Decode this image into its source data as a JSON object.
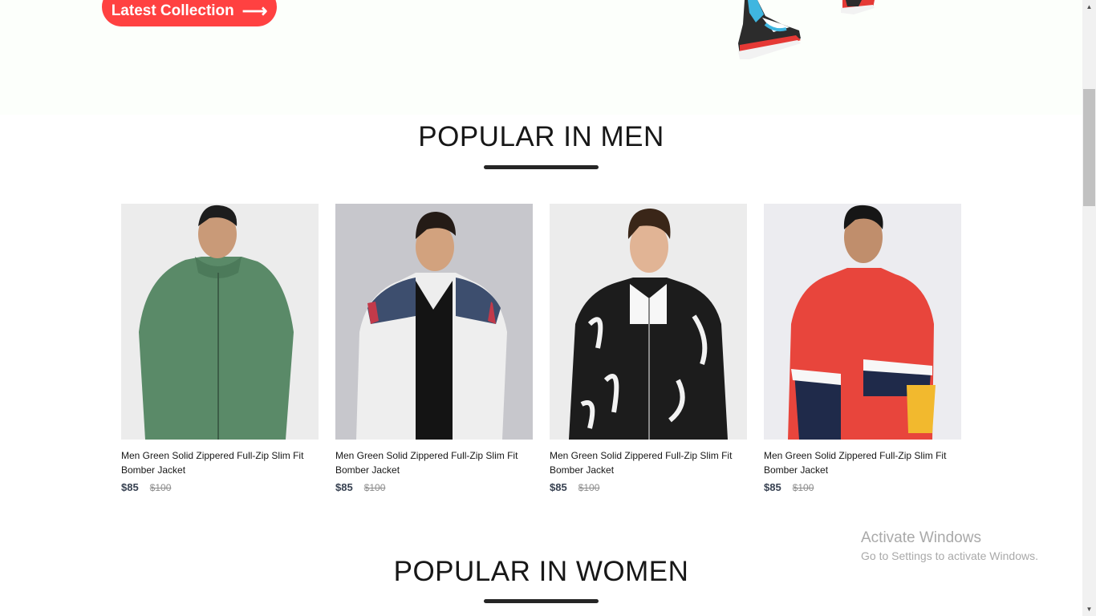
{
  "hero": {
    "button_label": "Latest Collection",
    "button_arrow": "⟶"
  },
  "sections": {
    "men_title": "POPULAR IN MEN",
    "women_title": "POPULAR IN WOMEN"
  },
  "products": [
    {
      "name": "Men Green Solid Zippered Full-Zip Slim Fit Bomber Jacket",
      "new_price": "$85",
      "old_price": "$100",
      "jacket_color": "#5a8a68"
    },
    {
      "name": "Men Green Solid Zippered Full-Zip Slim Fit Bomber Jacket",
      "new_price": "$85",
      "old_price": "$100",
      "jacket_color": "#eeeeee"
    },
    {
      "name": "Men Green Solid Zippered Full-Zip Slim Fit Bomber Jacket",
      "new_price": "$85",
      "old_price": "$100",
      "jacket_color": "#1c1c1c"
    },
    {
      "name": "Men Green Solid Zippered Full-Zip Slim Fit Bomber Jacket",
      "new_price": "$85",
      "old_price": "$100",
      "jacket_color": "#e8453c"
    }
  ],
  "windows_notice": {
    "title": "Activate Windows",
    "subtitle": "Go to Settings to activate Windows."
  },
  "colors": {
    "accent": "#ff4141",
    "title_bar": "#252525"
  }
}
